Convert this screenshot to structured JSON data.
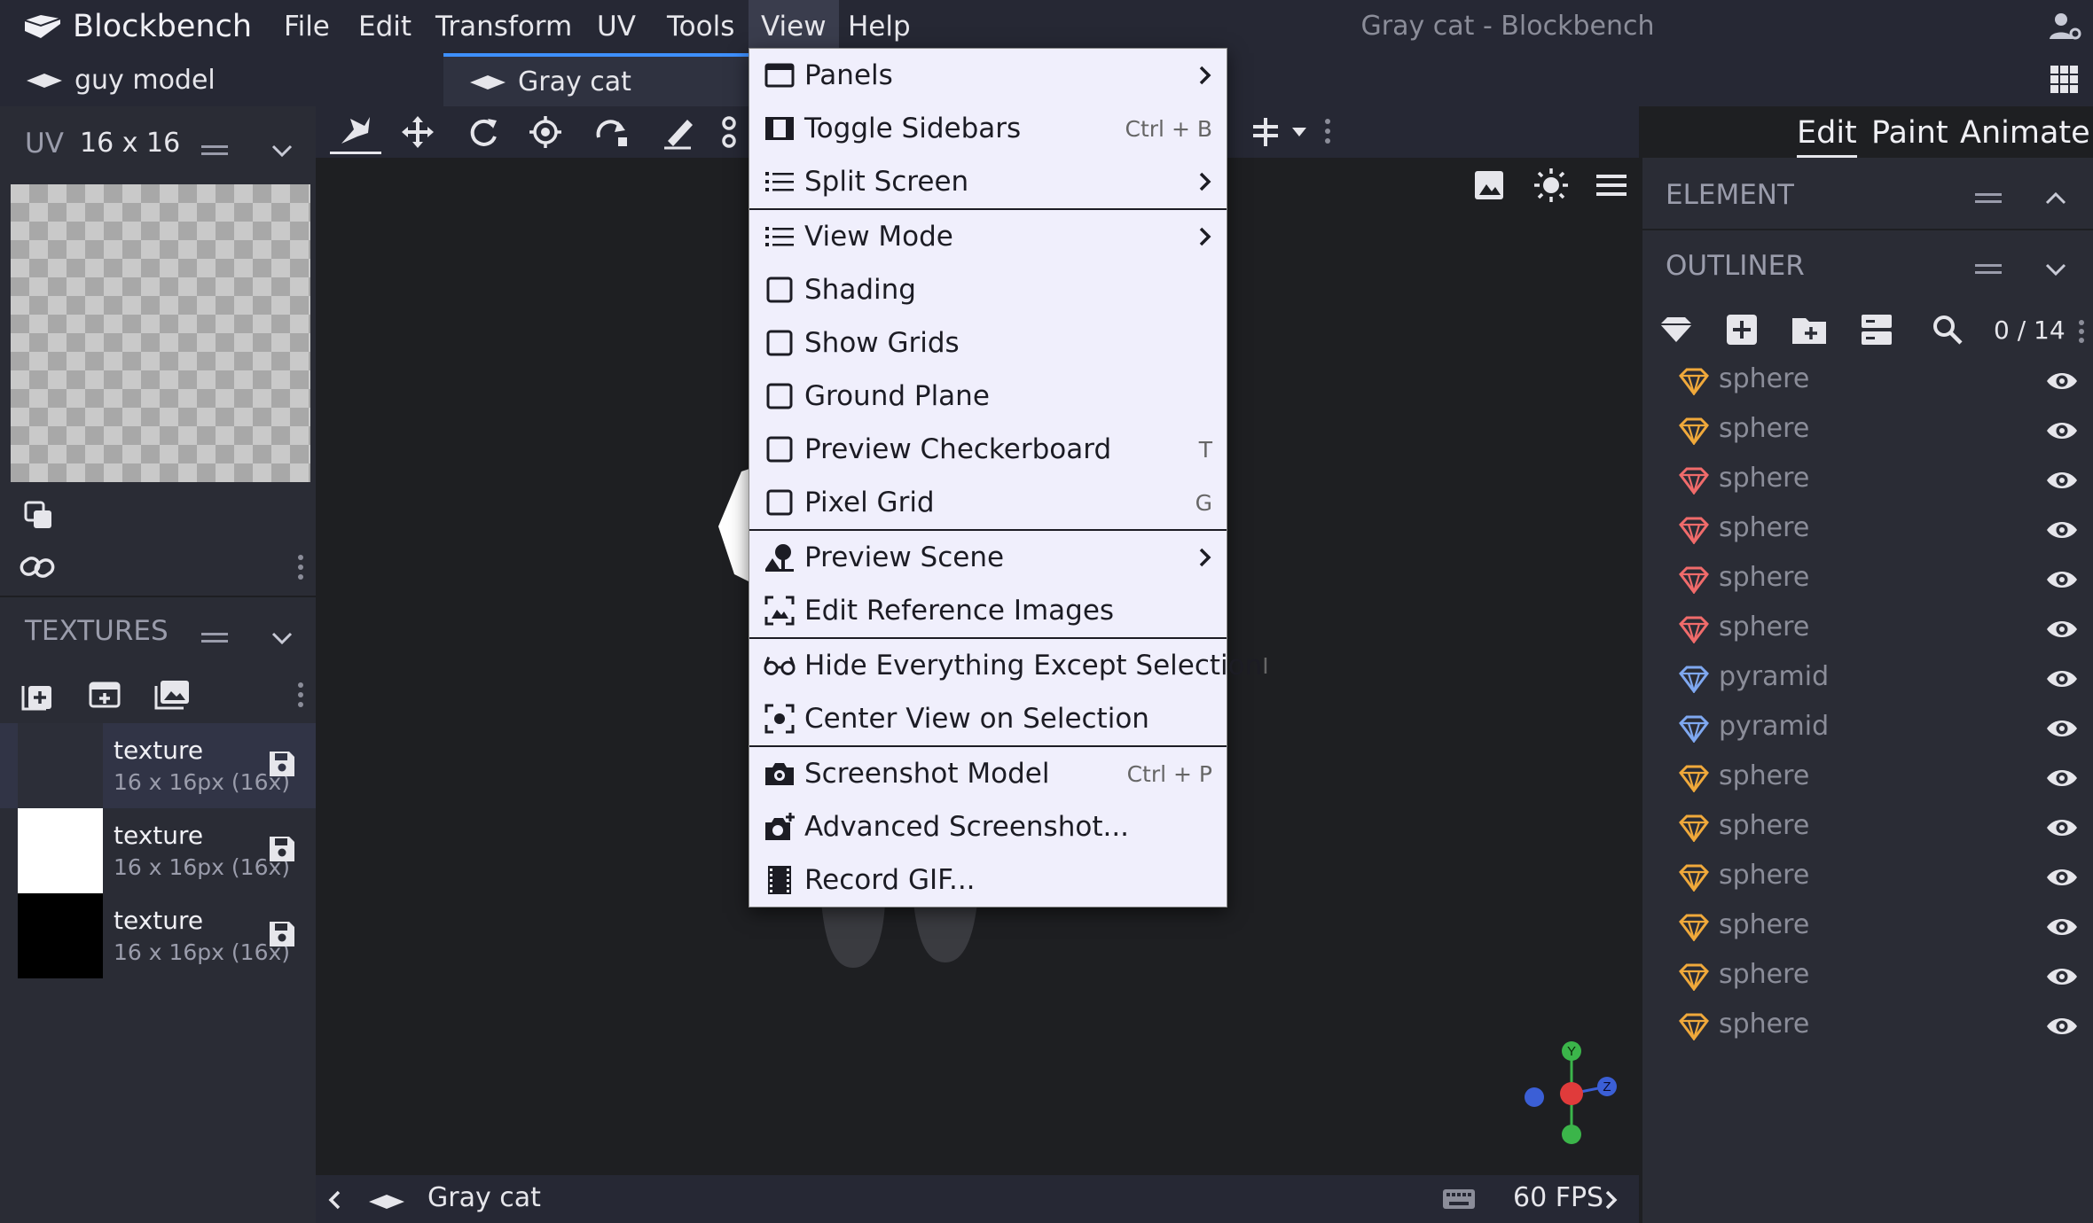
{
  "app": {
    "name": "Blockbench",
    "window_title": "Gray cat - Blockbench"
  },
  "menubar": {
    "items": [
      "File",
      "Edit",
      "Transform",
      "UV",
      "Tools",
      "View",
      "Help"
    ],
    "active": "View"
  },
  "tabs": [
    {
      "label": "guy model"
    },
    {
      "label": "Gray cat",
      "active": true
    }
  ],
  "uv_panel": {
    "title": "UV",
    "size": "16 x 16"
  },
  "textures_panel": {
    "title": "TEXTURES",
    "items": [
      {
        "name": "texture",
        "info": "16 x 16px (16x)",
        "swatch": "#2c2e38"
      },
      {
        "name": "texture",
        "info": "16 x 16px (16x)",
        "swatch": "#ffffff"
      },
      {
        "name": "texture",
        "info": "16 x 16px (16x)",
        "swatch": "#000000"
      }
    ]
  },
  "modes": [
    "Edit",
    "Paint",
    "Animate"
  ],
  "element_panel": {
    "title": "ELEMENT"
  },
  "outliner": {
    "title": "OUTLINER",
    "count": "0 / 14",
    "items": [
      {
        "name": "sphere",
        "color": "#f0a93b"
      },
      {
        "name": "sphere",
        "color": "#f0a93b"
      },
      {
        "name": "sphere",
        "color": "#f06b6b"
      },
      {
        "name": "sphere",
        "color": "#f06b6b"
      },
      {
        "name": "sphere",
        "color": "#f06b6b"
      },
      {
        "name": "sphere",
        "color": "#f06b6b"
      },
      {
        "name": "pyramid",
        "color": "#7fa8f0"
      },
      {
        "name": "pyramid",
        "color": "#7fa8f0"
      },
      {
        "name": "sphere",
        "color": "#f0a93b"
      },
      {
        "name": "sphere",
        "color": "#f0a93b"
      },
      {
        "name": "sphere",
        "color": "#f0a93b"
      },
      {
        "name": "sphere",
        "color": "#f0a93b"
      },
      {
        "name": "sphere",
        "color": "#f0a93b"
      },
      {
        "name": "sphere",
        "color": "#f0a93b"
      }
    ]
  },
  "view_menu": {
    "items": [
      {
        "label": "Panels",
        "icon": "panel-icon",
        "submenu": true
      },
      {
        "label": "Toggle Sidebars",
        "icon": "sidebars-icon",
        "shortcut": "Ctrl + B"
      },
      {
        "label": "Split Screen",
        "icon": "list-icon",
        "submenu": true
      },
      {
        "label": "View Mode",
        "icon": "list-icon",
        "submenu": true
      },
      {
        "label": "Shading",
        "icon": "checkbox-icon"
      },
      {
        "label": "Show Grids",
        "icon": "checkbox-icon"
      },
      {
        "label": "Ground Plane",
        "icon": "checkbox-icon"
      },
      {
        "label": "Preview Checkerboard",
        "icon": "checkbox-icon",
        "shortcut": "T"
      },
      {
        "label": "Pixel Grid",
        "icon": "checkbox-icon",
        "shortcut": "G"
      },
      {
        "label": "Preview Scene",
        "icon": "scene-icon",
        "submenu": true
      },
      {
        "label": "Edit Reference Images",
        "icon": "reference-image-icon"
      },
      {
        "label": "Hide Everything Except Selection",
        "icon": "glasses-icon",
        "shortcut": "I"
      },
      {
        "label": "Center View on Selection",
        "icon": "center-focus-icon"
      },
      {
        "label": "Screenshot Model",
        "icon": "camera-icon",
        "shortcut": "Ctrl + P"
      },
      {
        "label": "Advanced Screenshot...",
        "icon": "camera-plus-icon"
      },
      {
        "label": "Record GIF...",
        "icon": "film-icon"
      }
    ]
  },
  "viewport": {
    "title": "Gray cat",
    "fps": "60 FPS",
    "axes": {
      "y": "Y",
      "z": "Z"
    }
  },
  "colors": {
    "accent": "#3e90ff",
    "axis_x": "#e03b3b",
    "axis_y": "#3bb54a",
    "axis_z": "#3b5fd6"
  }
}
